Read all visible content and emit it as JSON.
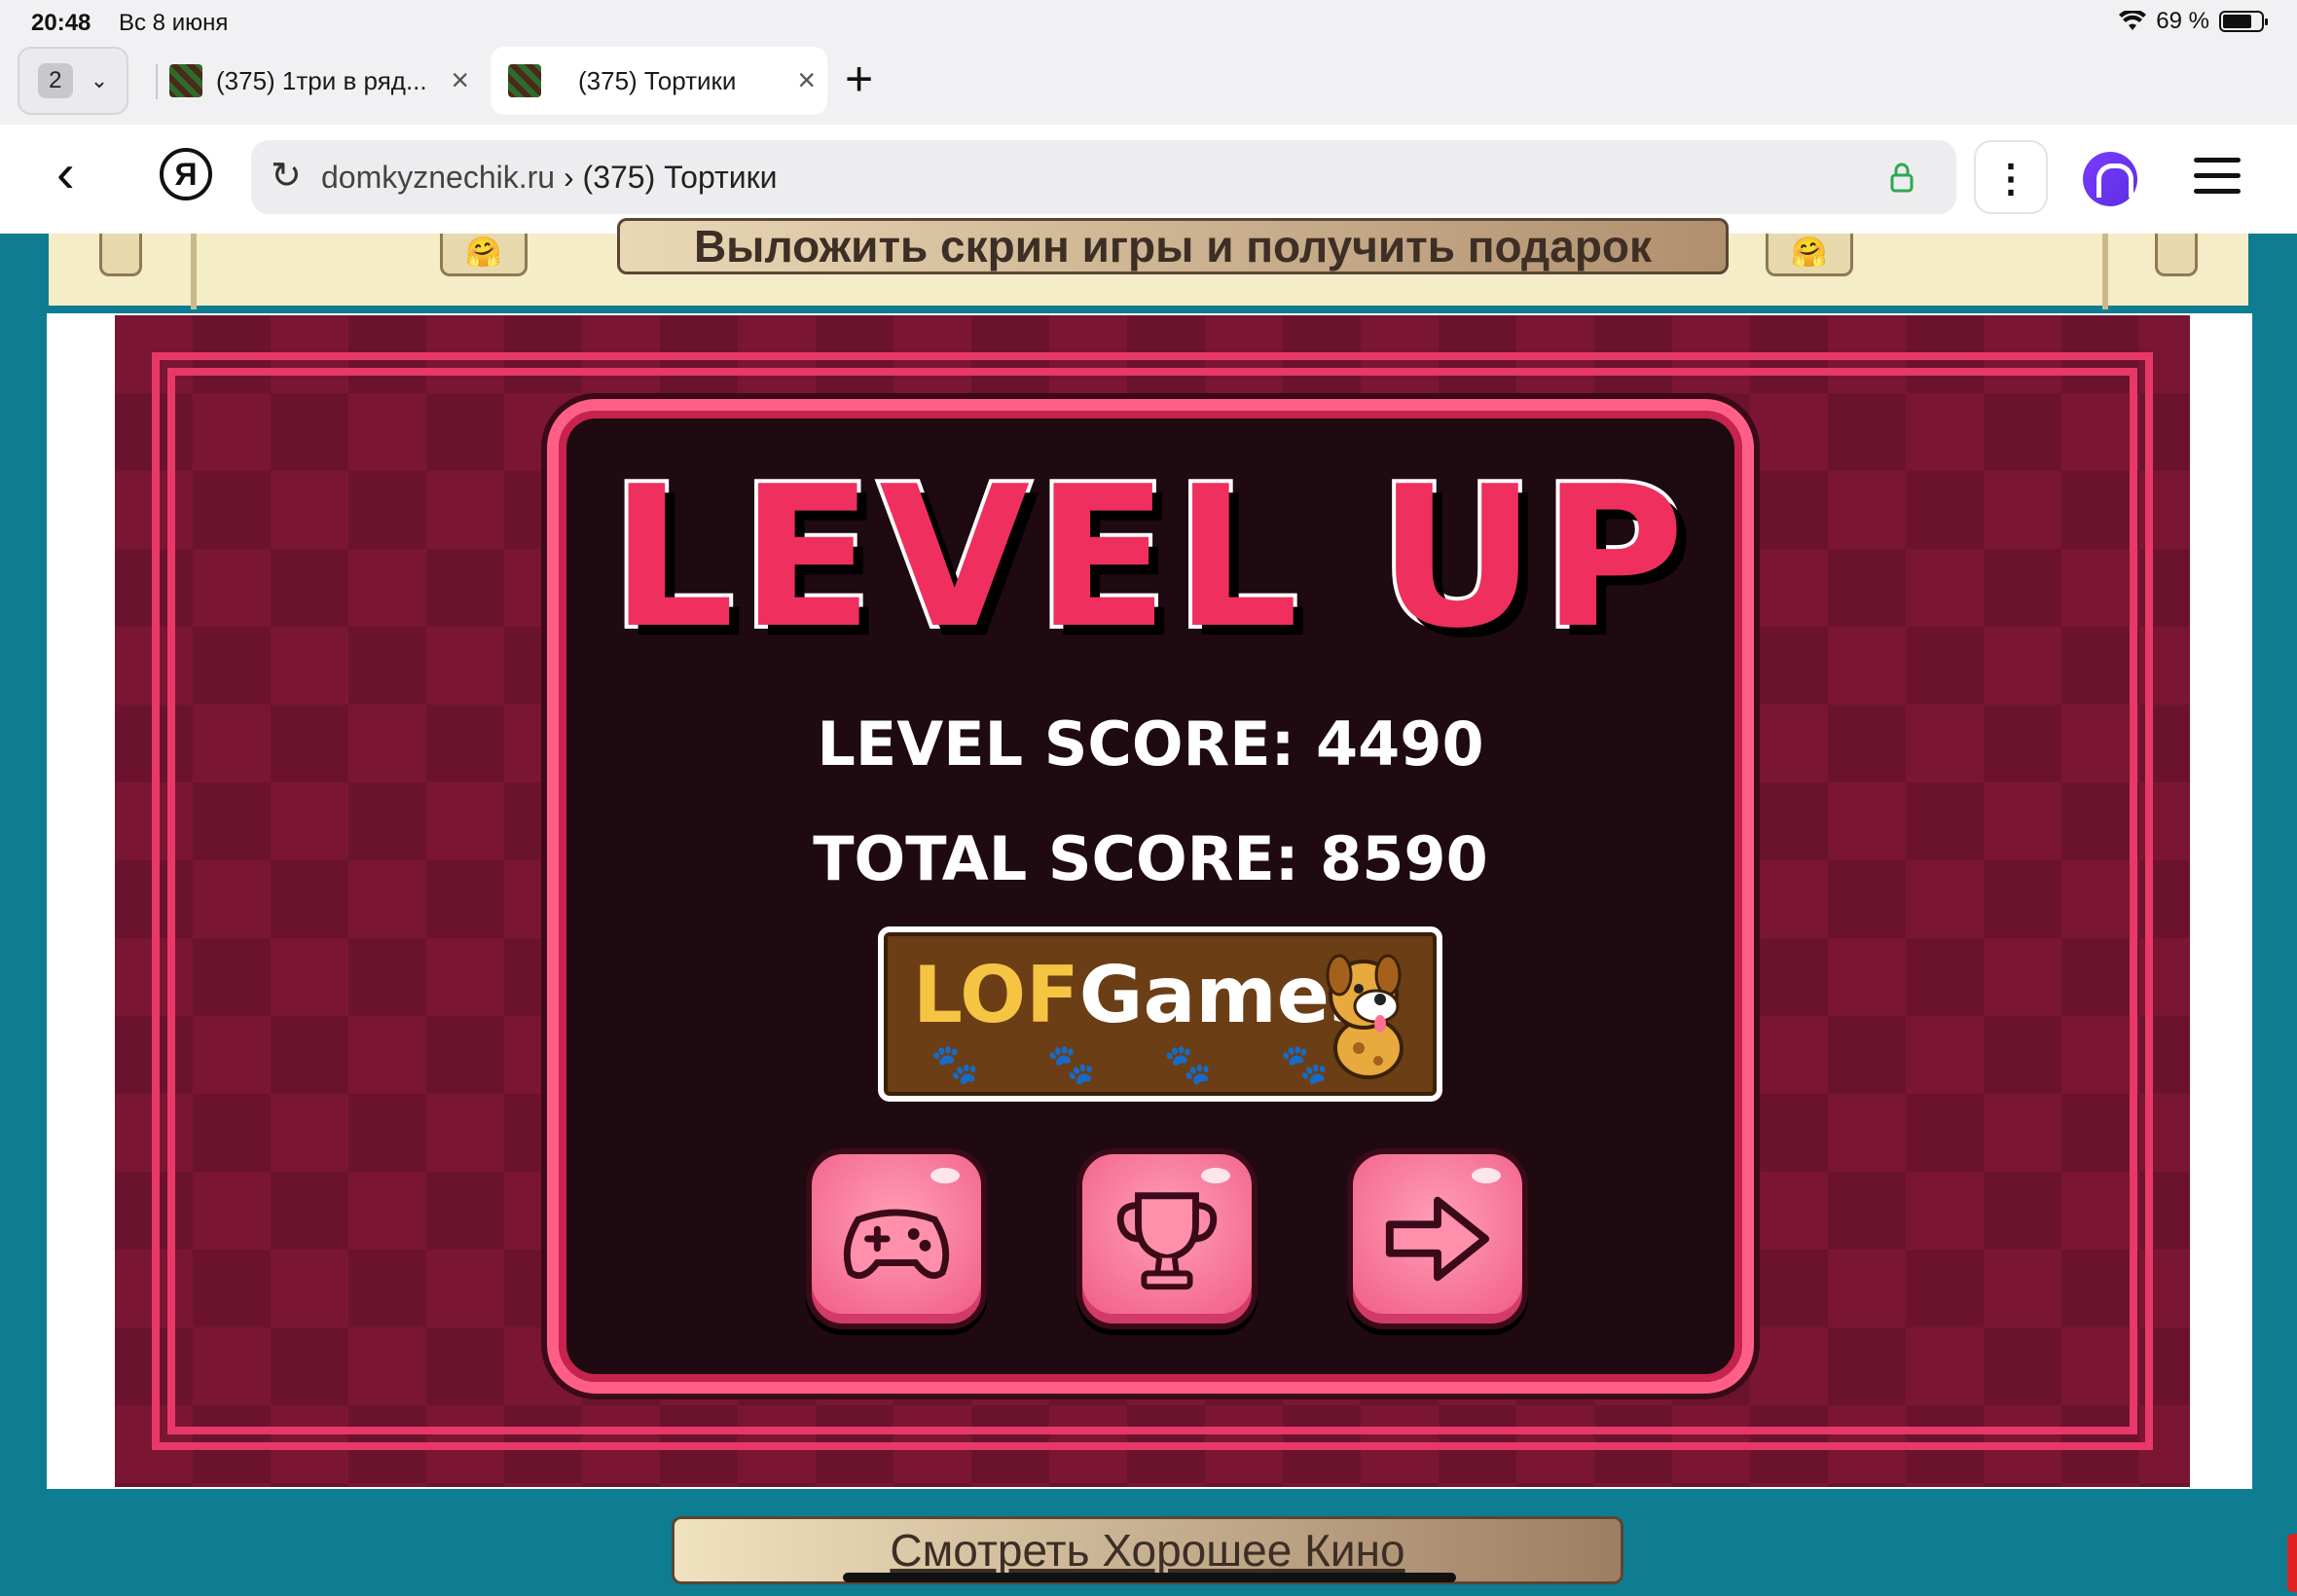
{
  "status_bar": {
    "time": "20:48",
    "date": "Вс 8 июня",
    "battery": "69 %",
    "battery_level_percent": 69
  },
  "tabs": {
    "count": "2",
    "items": [
      {
        "title": "(375) 1три в ряд..."
      },
      {
        "title": "(375) Тортики"
      }
    ]
  },
  "address_bar": {
    "domain": "domkyznechik.ru",
    "separator": " › ",
    "page_title": "(375) Тортики",
    "icons": [
      "back-icon",
      "yandex-icon",
      "reload-icon",
      "lock-icon",
      "more-icon",
      "alice-icon",
      "menu-icon"
    ]
  },
  "page": {
    "top_banner": "Выложить скрин игры и получить подарок",
    "bottom_banner": "Смотреть Хорошее Кино"
  },
  "game": {
    "title": "LEVEL UP",
    "level_score_label": "LEVEL SCORE: 4490",
    "total_score_label": "TOTAL SCORE: 8590",
    "logo_part1": "LOF",
    "logo_part2": "Games",
    "buttons": [
      {
        "icon": "gamepad-icon"
      },
      {
        "icon": "trophy-icon"
      },
      {
        "icon": "arrow-right-icon"
      }
    ],
    "colors": {
      "accent": "#ef2f5e",
      "panel_border": "#ff5f86",
      "background": "#7a1634"
    }
  }
}
